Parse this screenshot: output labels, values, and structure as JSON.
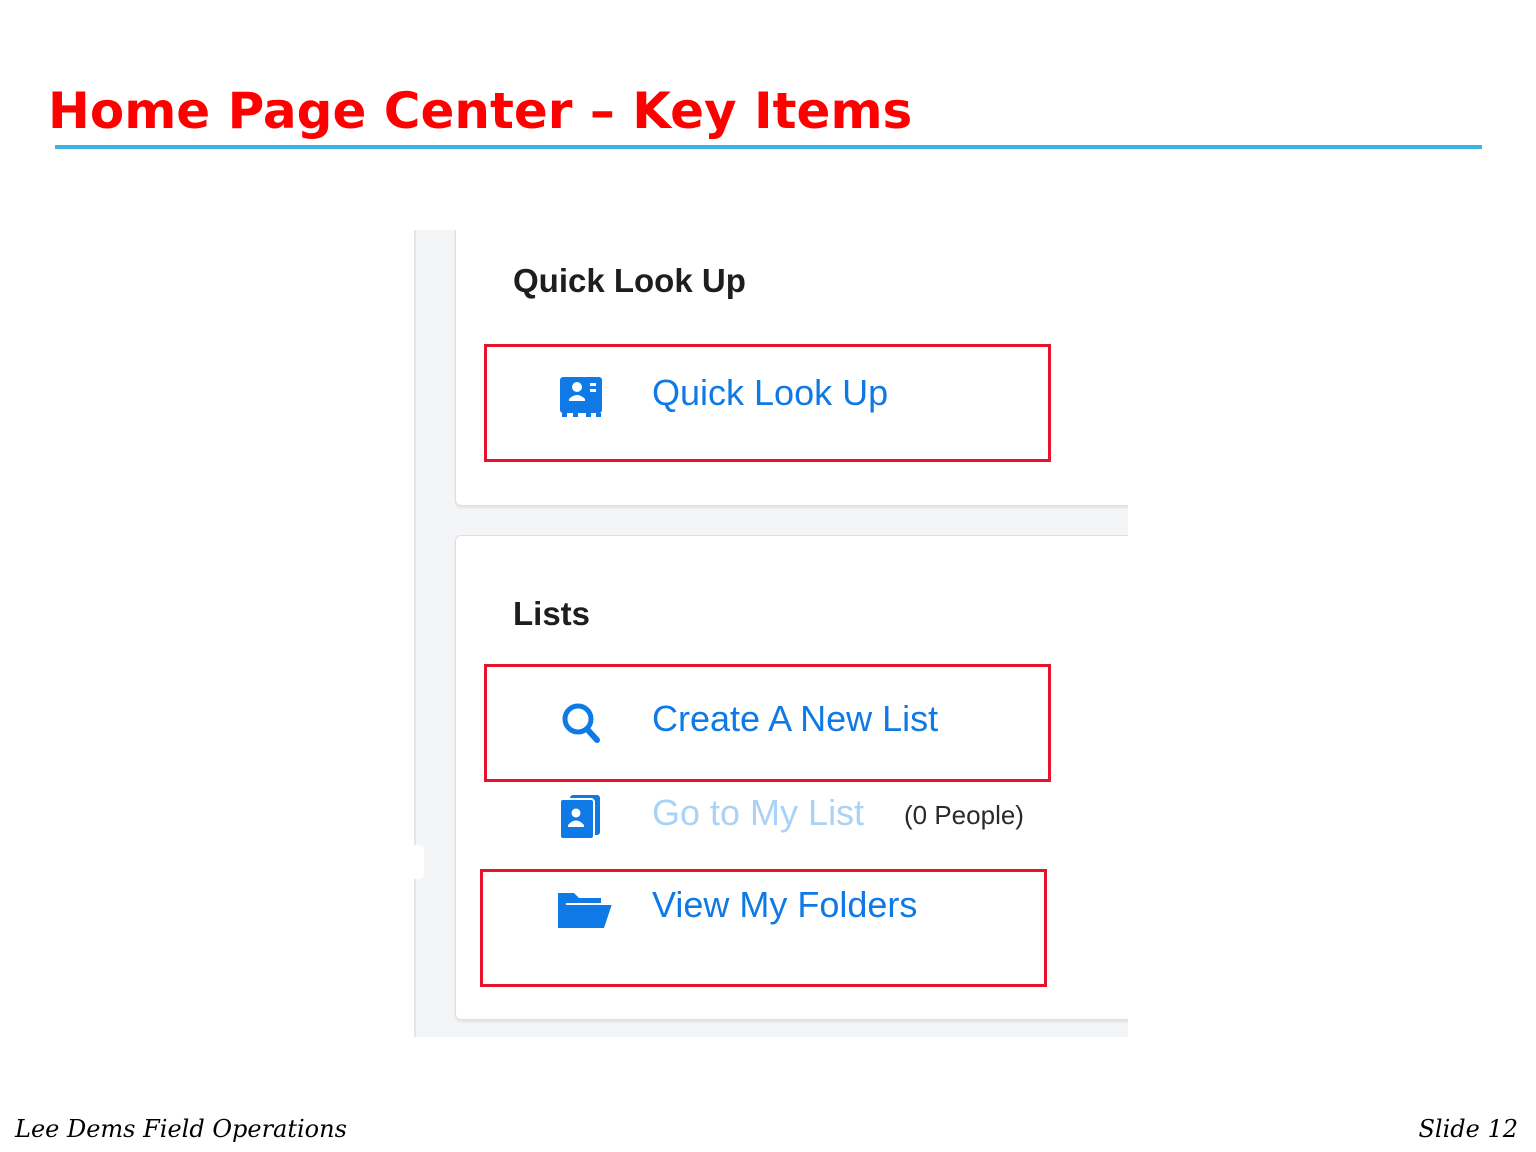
{
  "slide": {
    "title": "Home Page Center – Key Items",
    "footer_left": "Lee Dems Field Operations",
    "footer_right": "Slide 12"
  },
  "quick_look_up": {
    "heading": "Quick Look Up",
    "item": {
      "label": "Quick Look Up",
      "icon": "contact-card-icon"
    }
  },
  "lists": {
    "heading": "Lists",
    "items": [
      {
        "label": "Create A New List",
        "icon": "search-icon"
      },
      {
        "label": "Go to My List",
        "icon": "contact-book-icon",
        "count": "(0 People)",
        "disabled": true
      },
      {
        "label": "View My Folders",
        "icon": "folder-open-icon"
      }
    ]
  },
  "colors": {
    "title": "#ff0000",
    "title_rule": "#3bb3e3",
    "link": "#0f7ae5",
    "link_disabled": "#a9d2f5",
    "highlight": "#e8132a"
  }
}
